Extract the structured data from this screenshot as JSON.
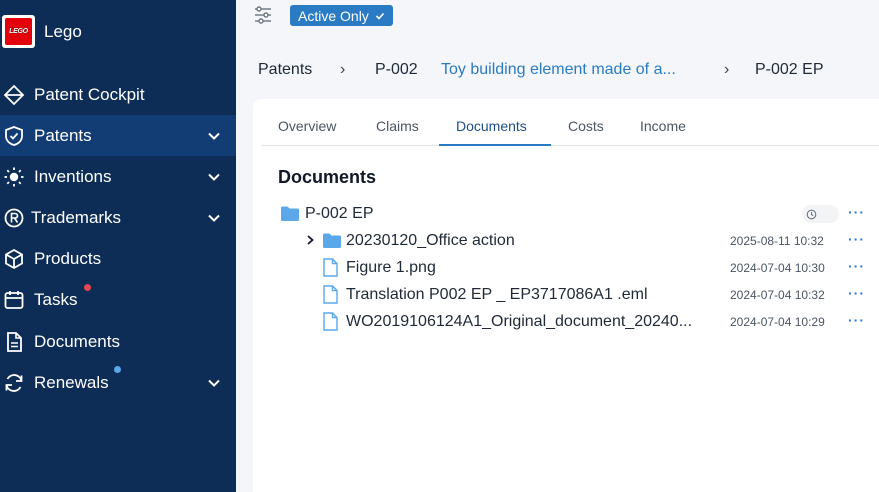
{
  "app": {
    "name": "Lego"
  },
  "sidebar": {
    "items": [
      {
        "label": "Patent Cockpit",
        "icon": "cockpit-icon"
      },
      {
        "label": "Patents",
        "icon": "shield-icon",
        "active": true
      },
      {
        "label": "Inventions",
        "icon": "bulb-icon"
      },
      {
        "label": "Trademarks",
        "icon": "registered-icon"
      },
      {
        "label": "Products",
        "icon": "cube-icon"
      },
      {
        "label": "Tasks",
        "icon": "calendar-icon",
        "badge_color": "#e5484d"
      },
      {
        "label": "Documents",
        "icon": "document-icon"
      },
      {
        "label": "Renewals",
        "icon": "refresh-icon",
        "badge_color": "#5aa8ea"
      }
    ]
  },
  "filter": {
    "active_label": "Active Only"
  },
  "breadcrumb": [
    {
      "label": "Patents"
    },
    {
      "label": "P-002"
    },
    {
      "label": "Toy building element made of a..."
    },
    {
      "label": "P-002 EP"
    }
  ],
  "tabs": [
    "Overview",
    "Claims",
    "Documents",
    "Costs",
    "Income"
  ],
  "active_tab": "Documents",
  "documents": {
    "title": "Documents",
    "root": {
      "name": "P-002 EP"
    },
    "items": [
      {
        "type": "folder",
        "name": "20230120_Office action",
        "date": "2025-08-11 10:32"
      },
      {
        "type": "file",
        "name": "Figure 1.png",
        "date": "2024-07-04 10:30"
      },
      {
        "type": "file",
        "name": "Translation P002 EP _ EP3717086A1 .eml",
        "date": "2024-07-04 10:32"
      },
      {
        "type": "file",
        "name": "WO2019106124A1_Original_document_20240...",
        "date": "2024-07-04 10:29"
      }
    ],
    "more_label": "···"
  },
  "colors": {
    "sidebar_bg": "#0d2d57",
    "sidebar_active": "#123d74",
    "accent": "#2a7bc4",
    "folder": "#5aa8ea"
  }
}
